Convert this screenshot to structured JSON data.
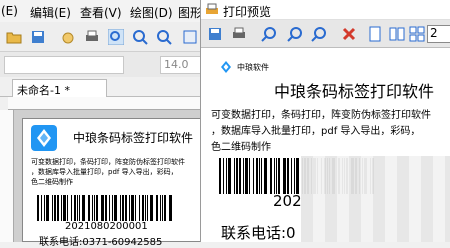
{
  "menubar": {
    "items": [
      "(E)",
      "编辑(E)",
      "查看(V)",
      "绘图(D)",
      "图形("
    ]
  },
  "toolbar": {
    "font_size_value": "14.0"
  },
  "document": {
    "tab_label": "未命名-1 *"
  },
  "label": {
    "logo_text": "中琅软件",
    "title": "中琅条码标签打印软件",
    "line1": "可变数据打印，条码打印，阵变防伪标签打印软件",
    "line2": "，数据库导入批量打印，pdf 导入导出，彩码，",
    "line3": "色二维码制作",
    "barcode_number": "2021080200001",
    "phone": "联系电话:0371-60942585"
  },
  "preview": {
    "window_title": "打印预览",
    "page_input": "2",
    "logo_text": "中琅软件",
    "title": "中琅条码标签打印软件",
    "line1": "可变数据打印，条码打印，阵变防伪标签打印软件",
    "line2": "，数据库导入批量打印，pdf 导入导出，彩码，",
    "line3": "色二维码制作",
    "barcode_number": "202",
    "phone": "联系电话:0"
  },
  "colors": {
    "accent_blue": "#1e88e5",
    "logo_blue": "#2196f3",
    "zoom_blue": "#2a6bd0",
    "delete_red": "#d33a2c",
    "printer_orange": "#e8a534"
  }
}
